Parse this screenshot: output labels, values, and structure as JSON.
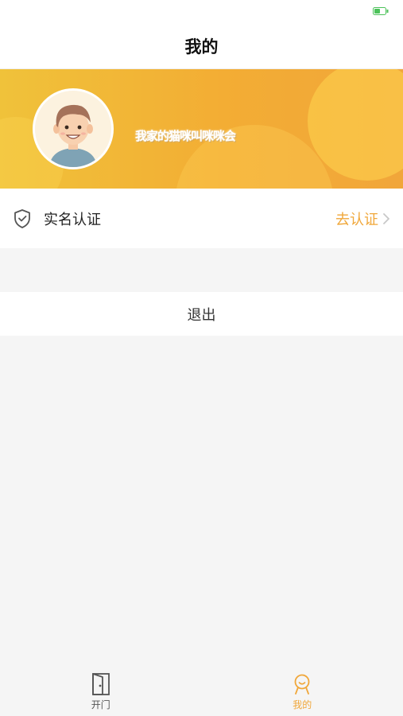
{
  "nav": {
    "title": "我的"
  },
  "profile": {
    "username": "我家的猫咪叫咪咪会"
  },
  "auth_row": {
    "label": "实名认证",
    "action": "去认证"
  },
  "logout": {
    "label": "退出"
  },
  "tabs": [
    {
      "label": "开门",
      "icon": "door-icon",
      "active": false
    },
    {
      "label": "我的",
      "icon": "profile-icon",
      "active": true
    }
  ],
  "colors": {
    "accent": "#f0a73a",
    "banner_start": "#f0c23a",
    "banner_end": "#f1a63a",
    "battery": "#4cc25a"
  }
}
